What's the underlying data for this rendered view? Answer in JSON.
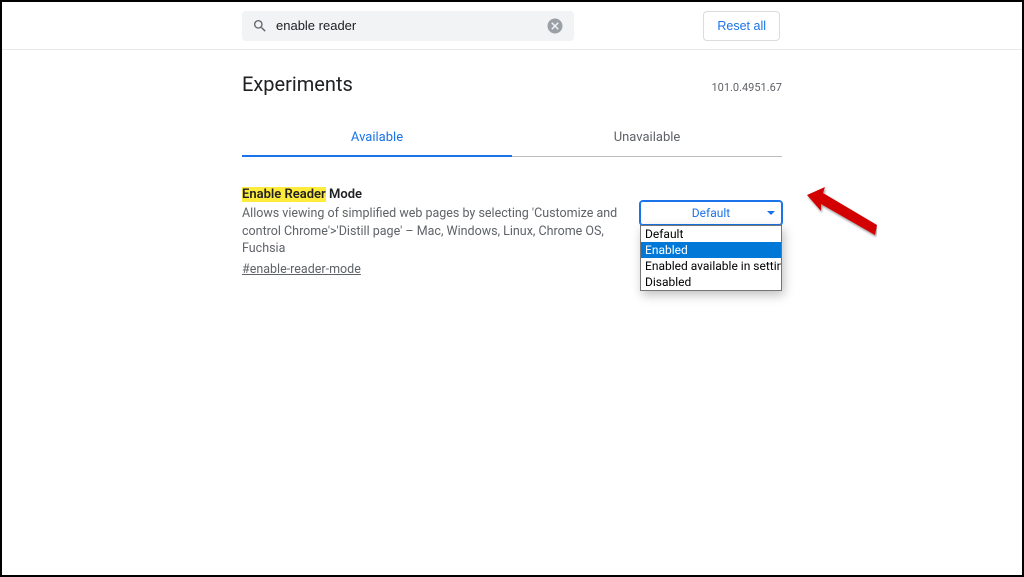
{
  "search": {
    "value": "enable reader",
    "reset": "Reset all"
  },
  "header": {
    "title": "Experiments",
    "version": "101.0.4951.67"
  },
  "tabs": {
    "available": "Available",
    "unavailable": "Unavailable"
  },
  "flag": {
    "title_hl": "Enable Reader",
    "title_rest": " Mode",
    "desc": "Allows viewing of simplified web pages by selecting 'Customize and control Chrome'>'Distill page' – Mac, Windows, Linux, Chrome OS, Fuchsia",
    "link": "#enable-reader-mode"
  },
  "select": {
    "value": "Default",
    "options": [
      "Default",
      "Enabled",
      "Enabled available in settings",
      "Disabled"
    ],
    "highlighted": "Enabled"
  }
}
